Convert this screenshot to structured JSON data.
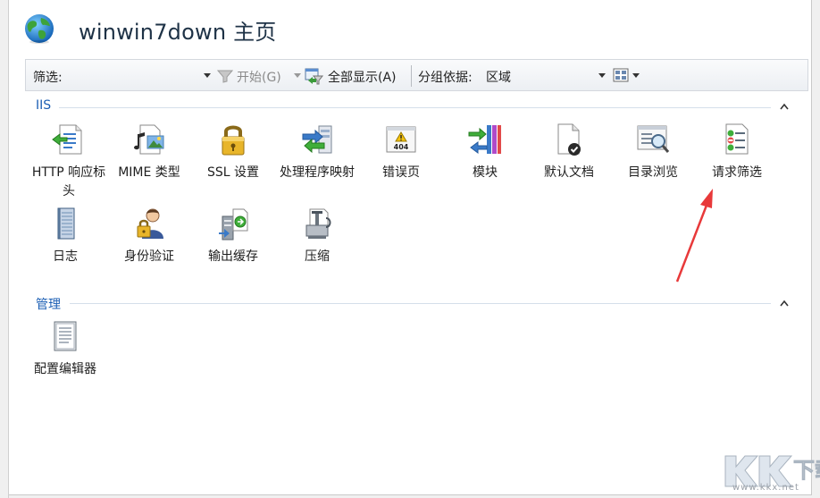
{
  "header": {
    "title": "winwin7down 主页"
  },
  "toolbar": {
    "filter_label": "筛选:",
    "filter_value": "",
    "start_label": "开始(G)",
    "show_all_label": "全部显示(A)",
    "group_by_label": "分组依据:",
    "group_by_value": "区域"
  },
  "sections": {
    "iis": {
      "title": "IIS",
      "items": [
        {
          "label": "HTTP 响应标头",
          "icon": "http-response-headers-icon"
        },
        {
          "label": "MIME 类型",
          "icon": "mime-types-icon"
        },
        {
          "label": "SSL 设置",
          "icon": "lock-icon"
        },
        {
          "label": "处理程序映射",
          "icon": "handler-mappings-icon"
        },
        {
          "label": "错误页",
          "icon": "error-pages-404-icon"
        },
        {
          "label": "模块",
          "icon": "modules-icon"
        },
        {
          "label": "默认文档",
          "icon": "default-document-icon"
        },
        {
          "label": "目录浏览",
          "icon": "directory-browsing-icon"
        },
        {
          "label": "请求筛选",
          "icon": "request-filtering-icon"
        },
        {
          "label": "日志",
          "icon": "logging-icon"
        },
        {
          "label": "身份验证",
          "icon": "authentication-icon"
        },
        {
          "label": "输出缓存",
          "icon": "output-caching-icon"
        },
        {
          "label": "压缩",
          "icon": "compression-icon"
        }
      ]
    },
    "management": {
      "title": "管理",
      "items": [
        {
          "label": "配置编辑器",
          "icon": "configuration-editor-icon"
        }
      ]
    }
  },
  "watermark": {
    "logo": "KK下载",
    "url": "www.kkx.net"
  },
  "colors": {
    "section_heading": "#1c5fb4",
    "annotation_arrow": "#e8393a"
  }
}
